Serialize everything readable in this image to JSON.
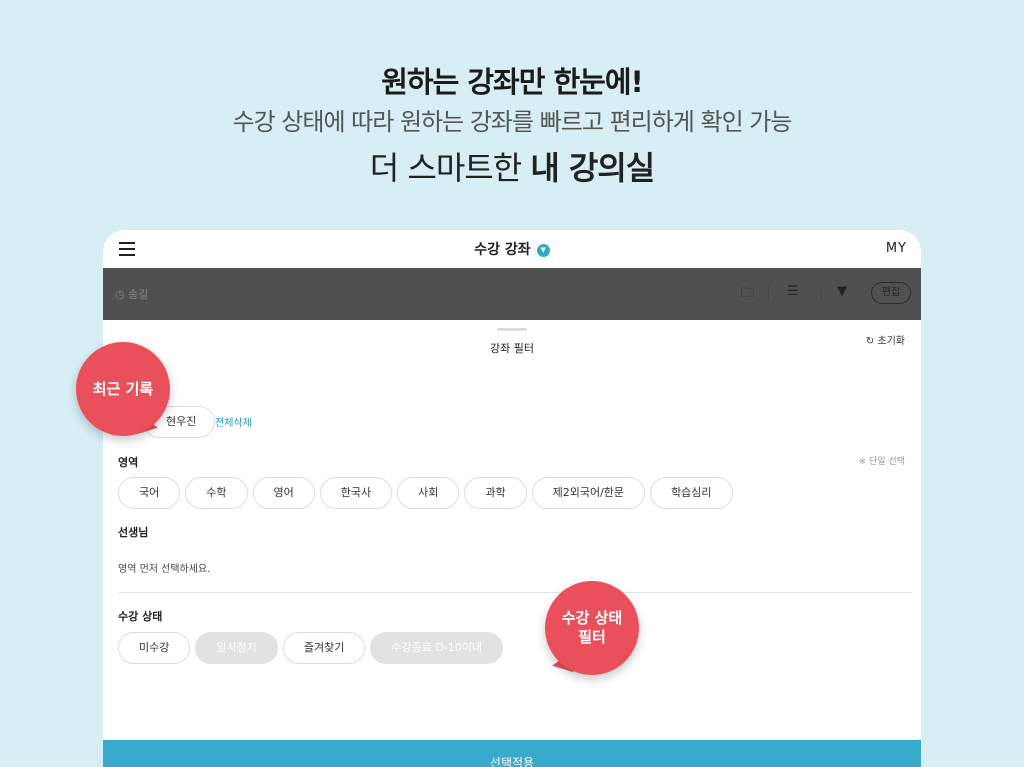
{
  "headline": {
    "line1": "원하는 강좌만 한눈에!",
    "line2": "수강 상태에 따라 원하는 강좌를 빠르고 편리하게 확인 가능",
    "line3_prefix": "더 스마트한 ",
    "line3_bold": "내 강의실"
  },
  "topbar": {
    "title": "수강 강좌",
    "caret_glyph": "▼",
    "my_label": "MY"
  },
  "toolbar": {
    "sort_label": "◷ 송길",
    "folder_icon_glyph": "🗀",
    "teacher_icon_glyph": "☰",
    "filter_icon_glyph": "▼",
    "edit_label": "편집"
  },
  "filter_sheet": {
    "title": "강좌 필터",
    "reset_label": "↻ 초기화",
    "recent": {
      "chip_label": "현우진",
      "clear_all_label": "전체삭제"
    },
    "area": {
      "label": "영역",
      "single_select_note": "※ 단일 선택",
      "options": [
        "국어",
        "수학",
        "영어",
        "한국사",
        "사회",
        "과학",
        "제2외국어/한문",
        "학습심리"
      ]
    },
    "teacher": {
      "label": "선생님",
      "hint": "영역 먼저 선택하세요."
    },
    "status": {
      "label": "수강 상태",
      "options": [
        {
          "label": "미수강",
          "disabled": false
        },
        {
          "label": "일시정지",
          "disabled": true
        },
        {
          "label": "즐겨찾기",
          "disabled": false
        },
        {
          "label": "수강종료 D-10이내",
          "disabled": true
        }
      ]
    },
    "apply_label": "선택적용"
  },
  "callouts": {
    "recent": "최근 기록",
    "status_line1": "수강 상태",
    "status_line2": "필터"
  },
  "colors": {
    "background": "#d7eef5",
    "accent": "#38aacd",
    "callout": "#e9505c",
    "toolbar": "#505050"
  }
}
